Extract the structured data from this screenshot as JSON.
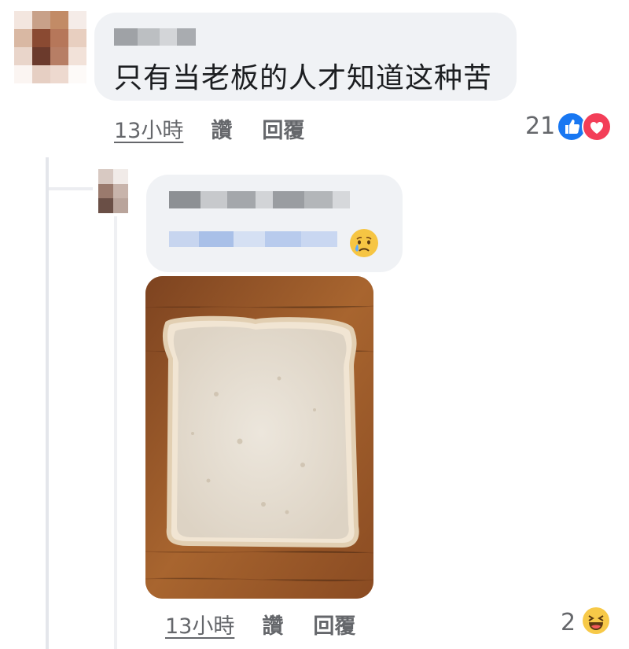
{
  "comment": {
    "text": "只有当老板的人才知道这种苦",
    "time": "13小時",
    "like_label": "讚",
    "reply_label": "回覆",
    "reaction_count": "21",
    "reactions": [
      "like-icon",
      "love-icon"
    ],
    "colors": {
      "like": "#1877f2",
      "love": "#f33e58"
    }
  },
  "reply": {
    "time": "13小時",
    "like_label": "讚",
    "reply_label": "回覆",
    "reaction_count": "2",
    "reactions": [
      "haha-icon"
    ],
    "text_emoji": "crying-face-icon",
    "attachment": "bread-slice-photo"
  }
}
